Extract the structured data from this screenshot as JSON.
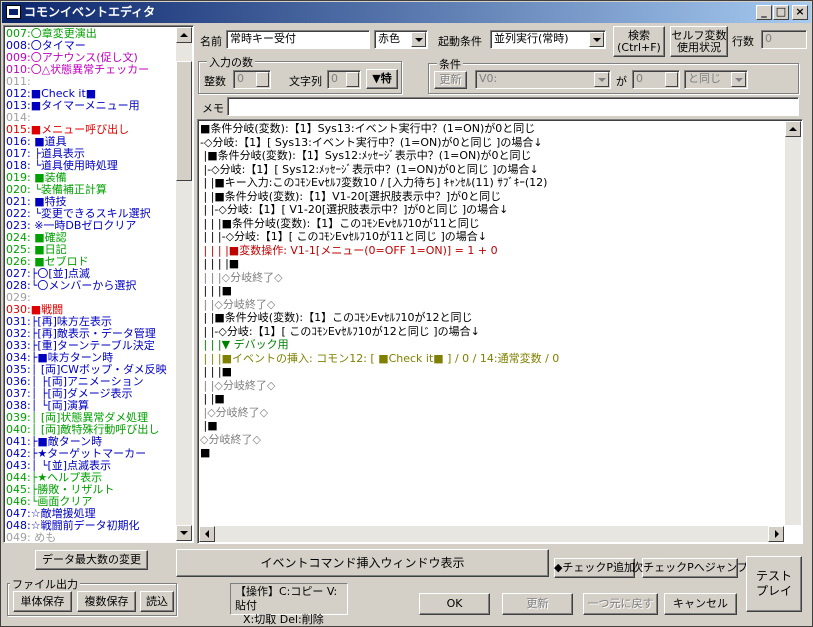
{
  "window": {
    "title": "コモンイベントエディタ",
    "min": "_",
    "max": "□",
    "close": "×"
  },
  "event_list": [
    {
      "text": "007:〇章変更演出",
      "color": "#00a000"
    },
    {
      "text": "008:〇タイマー",
      "color": "#0000c0"
    },
    {
      "text": "009:〇アナウンス(促し文)",
      "color": "#c000c0"
    },
    {
      "text": "010:〇△状態異常チェッカー",
      "color": "#c000c0"
    },
    {
      "text": "011:",
      "color": "#a0a0a0"
    },
    {
      "text": "012:■Check it■",
      "color": "#0000c0"
    },
    {
      "text": "013:■タイマーメニュー用",
      "color": "#0000c0"
    },
    {
      "text": "014:",
      "color": "#a0a0a0"
    },
    {
      "text": "015:■メニュー呼び出し",
      "color": "#e00000"
    },
    {
      "text": "016:  ■道具",
      "color": "#0000c0"
    },
    {
      "text": "017:  ├道具表示",
      "color": "#0000c0"
    },
    {
      "text": "018:  └道具使用時処理",
      "color": "#0000c0"
    },
    {
      "text": "019:  ■装備",
      "color": "#00a000"
    },
    {
      "text": "020:  └装備補正計算",
      "color": "#00a000"
    },
    {
      "text": "021:  ■特技",
      "color": "#0000c0"
    },
    {
      "text": "022:  └変更できるスキル選択",
      "color": "#0000c0"
    },
    {
      "text": "023:  ※一時DBゼロクリア",
      "color": "#0000c0"
    },
    {
      "text": "024:  ■確認",
      "color": "#00a000"
    },
    {
      "text": "025:  ■日記",
      "color": "#00a000"
    },
    {
      "text": "026:  ■セブロド",
      "color": "#00a000"
    },
    {
      "text": "027:├〇[並]点滅",
      "color": "#0000c0"
    },
    {
      "text": "028:└〇メンバーから選択",
      "color": "#0000c0"
    },
    {
      "text": "029:",
      "color": "#a0a0a0"
    },
    {
      "text": "030:■戦闘",
      "color": "#e00000"
    },
    {
      "text": "031:├[再]味方左表示",
      "color": "#0000c0"
    },
    {
      "text": "032:├[再]敵表示・データ管理",
      "color": "#0000c0"
    },
    {
      "text": "033:├[重]ターンテーブル決定",
      "color": "#0000c0"
    },
    {
      "text": "034:├■味方ターン時",
      "color": "#0000c0"
    },
    {
      "text": "035:│ [両]CWボップ・ダメ反映",
      "color": "#0000c0"
    },
    {
      "text": "036:│  ├[両]アニメーション",
      "color": "#0000c0"
    },
    {
      "text": "037:│  ├[両]ダメージ表示",
      "color": "#0000c0"
    },
    {
      "text": "038:│  └[両]演算",
      "color": "#0000c0"
    },
    {
      "text": "039:│ [両]状態異常ダメ処理",
      "color": "#00a000"
    },
    {
      "text": "040:│ [両]敵特殊行動呼び出し",
      "color": "#00a000"
    },
    {
      "text": "041:├■敵ターン時",
      "color": "#0000c0"
    },
    {
      "text": "042:├★ターゲットマーカー",
      "color": "#0000c0"
    },
    {
      "text": "043:│  └[並]点滅表示",
      "color": "#0000c0"
    },
    {
      "text": "044:├★ヘルプ表示",
      "color": "#00a000"
    },
    {
      "text": "045:├勝敗・リザルト",
      "color": "#00a000"
    },
    {
      "text": "046:└画面クリア",
      "color": "#00a000"
    },
    {
      "text": "047:☆敵増援処理",
      "color": "#0000c0"
    },
    {
      "text": "048:☆戦闘前データ初期化",
      "color": "#0000c0"
    },
    {
      "text": "049: めも",
      "color": "#a0a0a0"
    }
  ],
  "header": {
    "name_label": "名前",
    "name_value": "常時キー受付",
    "color_value": "赤色",
    "trigger_label": "起動条件",
    "trigger_value": "並列実行(常時)",
    "search_btn": "検索\n(Ctrl+F)",
    "self_var_btn": "セルフ変数\n使用状況",
    "line_count_label": "行数",
    "line_count_value": "0"
  },
  "input": {
    "group_label": "入力の数",
    "int_label": "整数",
    "int_value": "0",
    "str_label": "文字列",
    "str_value": "0",
    "special_btn": "▼特"
  },
  "condition": {
    "group_label": "条件",
    "update_btn": "更新",
    "var_value": "V0:",
    "ga_label": "が",
    "num_value": "0",
    "op_value": "と同じ"
  },
  "memo_label": "メモ",
  "code_lines": [
    {
      "text": "■条件分岐(変数):【1】Sys13:イベント実行中？(1=ON)が0と同じ",
      "color": "#000000"
    },
    {
      "text": "-◇分岐:【1】[ Sys13:イベント実行中？(1=ON)が0と同じ ]の場合↓",
      "color": "#000000"
    },
    {
      "text": " |■条件分岐(変数):【1】Sys12:ﾒｯｾｰｼﾞ表示中？(1=ON)が0と同じ",
      "color": "#000000"
    },
    {
      "text": " |-◇分岐:【1】[ Sys12:ﾒｯｾｰｼﾞ表示中？(1=ON)が0と同じ ]の場合↓",
      "color": "#000000"
    },
    {
      "text": " | |■キー入力:このｺﾓﾝEvｾﾙﾌ変数10 / [入力待ち] ｷｬﾝｾﾙ(11) ｻﾌﾞｷｰ(12)",
      "color": "#000000"
    },
    {
      "text": " | |■条件分岐(変数):【1】V1-20[選択肢表示中？]が0と同じ",
      "color": "#000000"
    },
    {
      "text": " | |-◇分岐:【1】[ V1-20[選択肢表示中？]が0と同じ ]の場合↓",
      "color": "#000000"
    },
    {
      "text": " | | |■条件分岐(変数):【1】このｺﾓﾝEvｾﾙﾌ10が11と同じ",
      "color": "#000000"
    },
    {
      "text": " | | |-◇分岐:【1】[ このｺﾓﾝEvｾﾙﾌ10が11と同じ ]の場合↓",
      "color": "#000000"
    },
    {
      "text": " | | | |■変数操作: V1-1[メニュー(0=OFF 1=ON)] = 1 + 0",
      "color": "#c00000"
    },
    {
      "text": " | | | |■",
      "color": "#000000"
    },
    {
      "text": " | | |◇分岐終了◇",
      "color": "#808080"
    },
    {
      "text": " | | |■",
      "color": "#000000"
    },
    {
      "text": " | |◇分岐終了◇",
      "color": "#808080"
    },
    {
      "text": " | |■条件分岐(変数):【1】このｺﾓﾝEvｾﾙﾌ10が12と同じ",
      "color": "#000000"
    },
    {
      "text": " | |-◇分岐:【1】[ このｺﾓﾝEvｾﾙﾌ10が12と同じ ]の場合↓",
      "color": "#000000"
    },
    {
      "text": " | | |▼ デバック用",
      "color": "#008000"
    },
    {
      "text": " | | |■イベントの挿入: コモン12: [ ■Check it■ ] / 0 / 14:通常変数 / 0",
      "color": "#808000"
    },
    {
      "text": " | | |■",
      "color": "#000000"
    },
    {
      "text": " | |◇分岐終了◇",
      "color": "#808080"
    },
    {
      "text": " | |■",
      "color": "#000000"
    },
    {
      "text": " |◇分岐終了◇",
      "color": "#808080"
    },
    {
      "text": " |■",
      "color": "#000000"
    },
    {
      "text": "◇分岐終了◇",
      "color": "#808080"
    },
    {
      "text": "■",
      "color": "#000000"
    }
  ],
  "bottom": {
    "data_max_btn": "データ最大数の変更",
    "insert_cmd_btn": "イベントコマンド挿入ウィンドウ表示",
    "check_add_btn": "◆チェックP追加",
    "next_check_btn": "次チェックPへジャンプ",
    "test_play_btn": "テスト\nプレイ",
    "file_group_label": "ファイル出力",
    "single_save_btn": "単体保存",
    "multi_save_btn": "複数保存",
    "load_btn": "読込",
    "ops_line1": "【操作】C:コピー V:貼付",
    "ops_line2": "X:切取 Del:削除",
    "ok_btn": "OK",
    "update_btn": "更新",
    "undo_btn": "一つ元に戻す",
    "cancel_btn": "キャンセル"
  }
}
